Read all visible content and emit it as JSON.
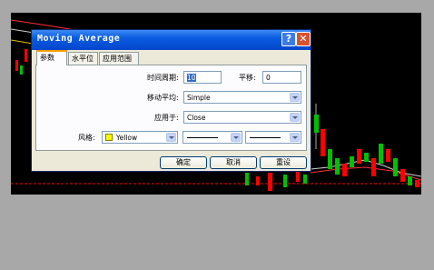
{
  "dialog": {
    "title": "Moving Average",
    "help_glyph": "?",
    "close_glyph": "✕",
    "tabs": [
      "参数",
      "水平位",
      "应用范围"
    ],
    "fields": {
      "period_label": "时间周期:",
      "period_value": "10",
      "shift_label": "平移:",
      "shift_value": "0",
      "method_label": "移动平均:",
      "method_value": "Simple",
      "apply_label": "应用于:",
      "apply_value": "Close",
      "style_label": "风格:",
      "color_value": "Yellow"
    },
    "buttons": {
      "ok": "确定",
      "cancel": "取消",
      "reset": "重设"
    }
  },
  "colors": {
    "title_bar": "#0a5ce0",
    "chart_bg": "#000000",
    "bull_candle": "#00c000",
    "bear_candle": "#ff0000",
    "color_swatch": "#ffff00"
  }
}
